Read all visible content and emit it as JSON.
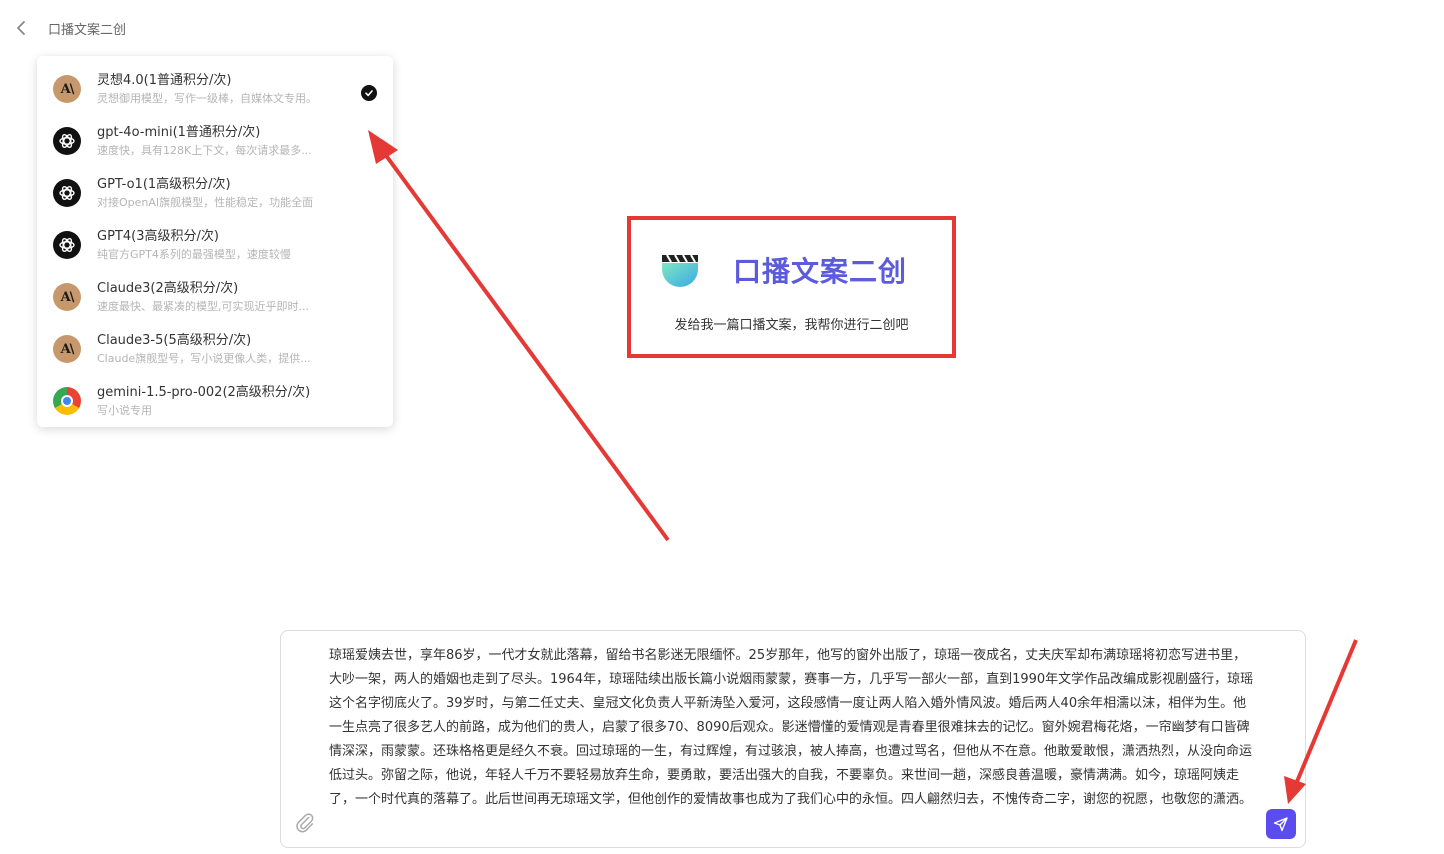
{
  "header": {
    "back_icon": "chevron-left-icon",
    "title": "口播文案二创"
  },
  "model_menu": {
    "selected_index": 0,
    "items": [
      {
        "name": "灵想4.0(1普通积分/次)",
        "desc": "灵想御用模型，写作一级棒，自媒体文专用。",
        "icon": "anthropic-icon"
      },
      {
        "name": "gpt-4o-mini(1普通积分/次)",
        "desc": "速度快，具有128K上下文，每次请求最多...",
        "icon": "openai-icon"
      },
      {
        "name": "GPT-o1(1高级积分/次)",
        "desc": "对接OpenAI旗舰模型，性能稳定，功能全面",
        "icon": "openai-icon"
      },
      {
        "name": "GPT4(3高级积分/次)",
        "desc": "纯官方GPT4系列的最强模型，速度较慢",
        "icon": "openai-icon"
      },
      {
        "name": "Claude3(2高级积分/次)",
        "desc": "速度最快、最紧凑的模型,可实现近乎即时...",
        "icon": "anthropic-icon"
      },
      {
        "name": "Claude3-5(5高级积分/次)",
        "desc": "Claude旗舰型号，写小说更像人类，提供...",
        "icon": "anthropic-icon"
      },
      {
        "name": "gemini-1.5-pro-002(2高级积分/次)",
        "desc": "写小说专用",
        "icon": "chrome-icon"
      }
    ]
  },
  "hero": {
    "title": "口播文案二创",
    "subtitle": "发给我一篇口播文案，我帮你进行二创吧",
    "logo_icon": "clapperboard-icon"
  },
  "composer": {
    "text": "琼瑶爱姨去世，享年86岁，一代才女就此落幕，留给书名影迷无限缅怀。25岁那年，他写的窗外出版了，琼瑶一夜成名，丈夫庆军却布满琼瑶将初恋写进书里，大吵一架，两人的婚姻也走到了尽头。1964年，琼瑶陆续出版长篇小说烟雨蒙蒙，赛事一方，几乎写一部火一部，直到1990年文学作品改编成影视剧盛行，琼瑶这个名字彻底火了。39岁时，与第二任丈夫、皇冠文化负责人平新涛坠入爱河，这段感情一度让两人陷入婚外情风波。婚后两人40余年相濡以沫，相伴为生。他一生点亮了很多艺人的前路，成为他们的贵人，启蒙了很多70、8090后观众。影迷懵懂的爱情观是青春里很难抹去的记忆。窗外婉君梅花烙，一帘幽梦有口皆碑情深深，雨蒙蒙。还珠格格更是经久不衰。回过琼瑶的一生，有过辉煌，有过骇浪，被人捧高，也遭过骂名，但他从不在意。他敢爱敢恨，潇洒热烈，从没向命运低过头。弥留之际，他说，年轻人千万不要轻易放弃生命，要勇敢，要活出强大的自我，不要辜负。来世间一趟，深感良善温暖，豪情满满。如今，琼瑶阿姨走了，一个时代真的落幕了。此后世间再无琼瑶文学，但他创作的爱情故事也成为了我们心中的永恒。四人翩然归去，不愧传奇二字，谢您的祝愿，也敬您的潇洒。",
    "attach_icon": "paperclip-icon",
    "send_icon": "send-icon"
  },
  "colors": {
    "accent": "#5b4cf0",
    "hero_title": "#5b5bdb",
    "annotation_red": "#e53935"
  }
}
